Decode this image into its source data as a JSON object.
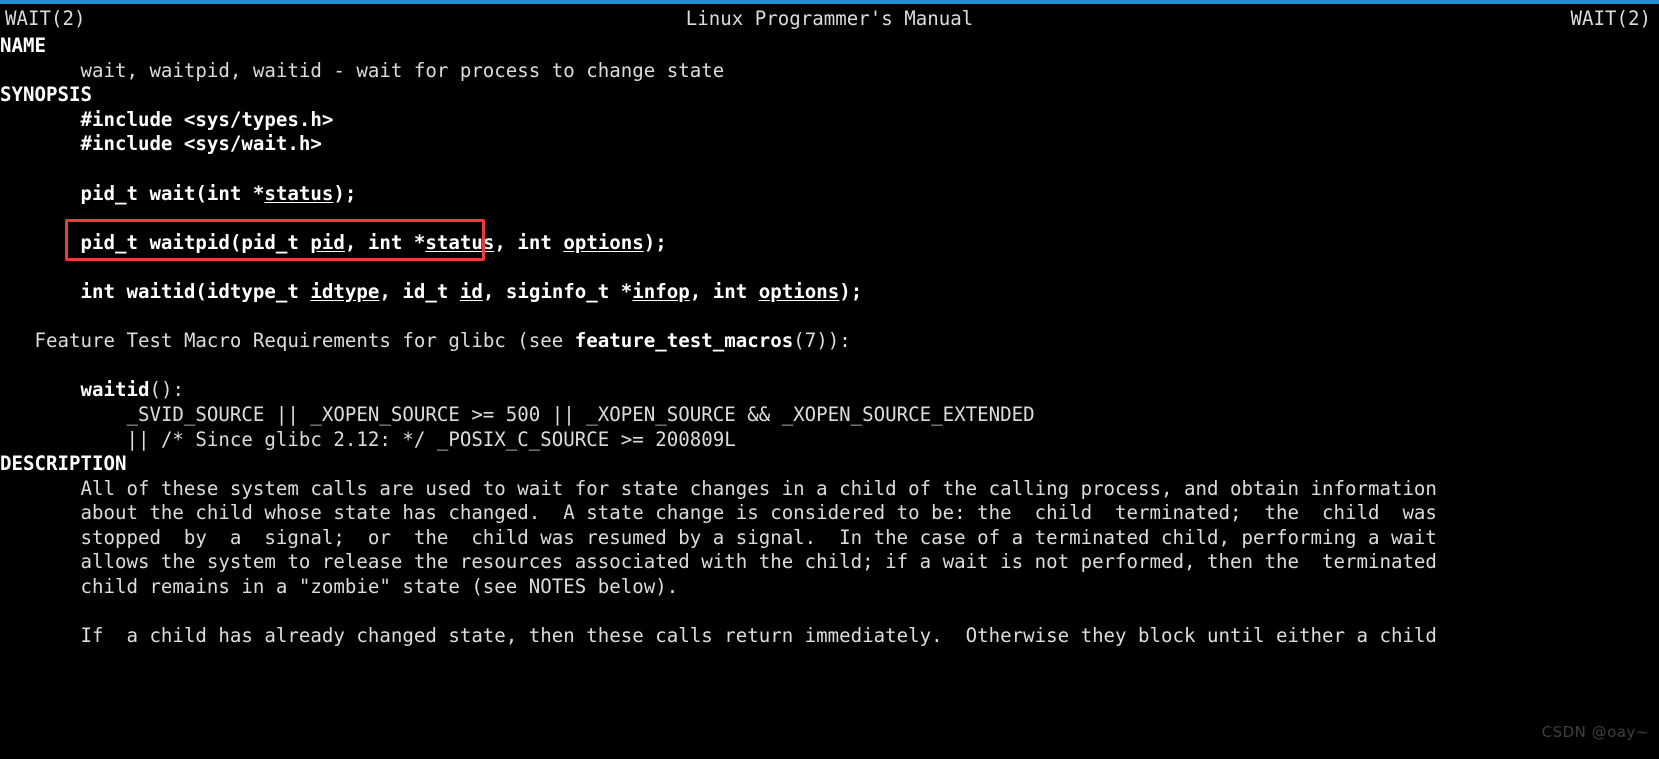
{
  "theme": {
    "background": "#000000",
    "foreground": "#dcdcdc",
    "bold_foreground": "#ffffff",
    "top_bar_accent": "#1e90d2",
    "annotation_color": "#f03a3a"
  },
  "header": {
    "left_title": "WAIT(2)",
    "center_title": "Linux Programmer's Manual",
    "right_title": "WAIT(2)"
  },
  "sections": {
    "name": {
      "heading": "NAME",
      "body": "wait, waitpid, waitid - wait for process to change state"
    },
    "synopsis": {
      "heading": "SYNOPSIS",
      "includes": [
        "#include <sys/types.h>",
        "#include <sys/wait.h>"
      ],
      "prototypes": [
        {
          "highlighted": true,
          "parts": [
            {
              "text": "pid_t wait(int *",
              "style": "bold"
            },
            {
              "text": "status",
              "style": "underline"
            },
            {
              "text": ");",
              "style": "bold"
            }
          ]
        },
        {
          "highlighted": false,
          "parts": [
            {
              "text": "pid_t waitpid(pid_t ",
              "style": "bold"
            },
            {
              "text": "pid",
              "style": "underline"
            },
            {
              "text": ", int *",
              "style": "bold"
            },
            {
              "text": "status",
              "style": "underline"
            },
            {
              "text": ", int ",
              "style": "bold"
            },
            {
              "text": "options",
              "style": "underline"
            },
            {
              "text": ");",
              "style": "bold"
            }
          ]
        },
        {
          "highlighted": false,
          "parts": [
            {
              "text": "int waitid(idtype_t ",
              "style": "bold"
            },
            {
              "text": "idtype",
              "style": "underline"
            },
            {
              "text": ", id_t ",
              "style": "bold"
            },
            {
              "text": "id",
              "style": "underline"
            },
            {
              "text": ", siginfo_t *",
              "style": "bold"
            },
            {
              "text": "infop",
              "style": "underline"
            },
            {
              "text": ", int ",
              "style": "bold"
            },
            {
              "text": "options",
              "style": "underline"
            },
            {
              "text": ");",
              "style": "bold"
            }
          ]
        }
      ],
      "feature_test_intro_pre": "Feature Test Macro Requirements for glibc (see ",
      "feature_test_link": "feature_test_macros",
      "feature_test_intro_post": "(7)):",
      "feature_block": {
        "function": "waitid",
        "function_suffix": "():",
        "lines": [
          "_SVID_SOURCE || _XOPEN_SOURCE >= 500 || _XOPEN_SOURCE && _XOPEN_SOURCE_EXTENDED",
          "|| /* Since glibc 2.12: */ _POSIX_C_SOURCE >= 200809L"
        ]
      }
    },
    "description": {
      "heading": "DESCRIPTION",
      "paragraph1": [
        "All of these system calls are used to wait for state changes in a child of the calling process, and obtain information",
        "about the child whose state has changed.  A state change is considered to be: the  child  terminated;  the  child  was",
        "stopped  by  a  signal;  or  the  child was resumed by a signal.  In the case of a terminated child, performing a wait",
        "allows the system to release the resources associated with the child; if a wait is not performed, then the  terminated",
        "child remains in a \"zombie\" state (see NOTES below)."
      ],
      "paragraph2": [
        "If  a child has already changed state, then these calls return immediately.  Otherwise they block until either a child"
      ]
    },
    "watermark": "CSDN @oay~"
  }
}
